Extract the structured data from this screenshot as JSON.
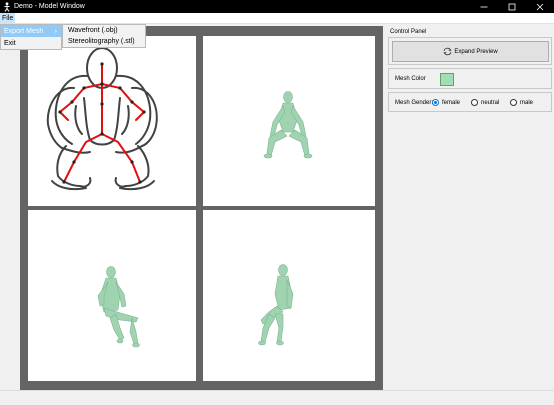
{
  "window": {
    "title": "Demo - Model Window",
    "controls": {
      "minimize": "—",
      "maximize": "☐",
      "close": "✕"
    }
  },
  "menubar": {
    "file_label": "File"
  },
  "file_menu": {
    "items": [
      {
        "label": "Export Mesh",
        "has_submenu": true
      },
      {
        "label": "Exit",
        "has_submenu": false
      }
    ],
    "submenu_arrow": "›"
  },
  "export_submenu": {
    "items": [
      {
        "label": "Wavefront (.obj)"
      },
      {
        "label": "Stereolitography (.stl)"
      }
    ]
  },
  "viewports": {
    "mesh_color": "#a0d4b0",
    "sketch_stroke_color": "#222222",
    "skeleton_color": "#e01010"
  },
  "control_panel": {
    "title": "Control Panel",
    "expand_preview_label": "Expand Preview",
    "mesh_color_label": "Mesh Color",
    "mesh_color_value": "#a0e0b0",
    "mesh_gender_label": "Mesh Gender:",
    "gender_options": [
      {
        "label": "female",
        "selected": true
      },
      {
        "label": "neutral",
        "selected": false
      },
      {
        "label": "male",
        "selected": false
      }
    ]
  }
}
